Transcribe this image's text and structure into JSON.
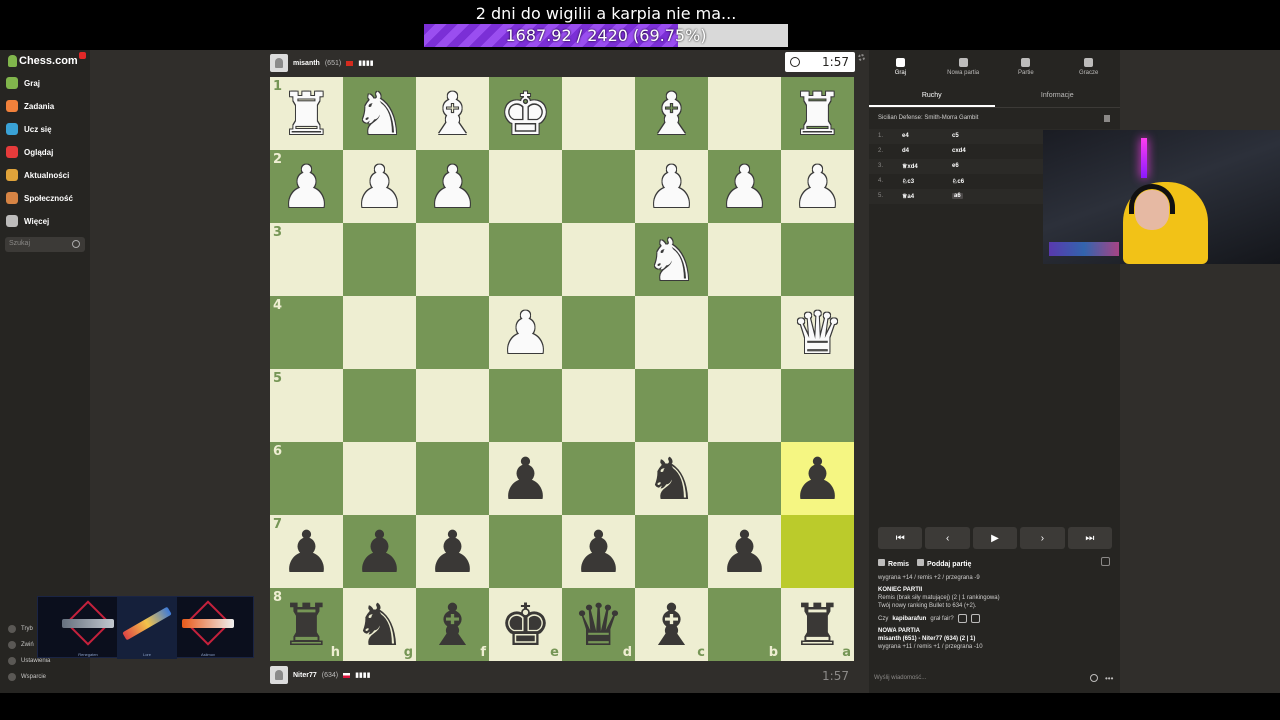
{
  "overlay": {
    "goal_title": "2 dni do wigilii a karpia nie ma...",
    "goal_text": "1687.92 / 2420 (69.75%)",
    "goal_progress": 0.6975
  },
  "sidebar": {
    "logo": "Chess.com",
    "items": [
      {
        "label": "Graj",
        "icon": "pawn-icon",
        "color": "#81b64c"
      },
      {
        "label": "Zadania",
        "icon": "puzzle-icon",
        "color": "#f1813b"
      },
      {
        "label": "Ucz się",
        "icon": "learn-icon",
        "color": "#3aa2d6"
      },
      {
        "label": "Oglądaj",
        "icon": "watch-icon",
        "color": "#e63b3b"
      },
      {
        "label": "Aktualności",
        "icon": "news-icon",
        "color": "#e0a33a"
      },
      {
        "label": "Społeczność",
        "icon": "community-icon",
        "color": "#d78444"
      },
      {
        "label": "Więcej",
        "icon": "more-icon",
        "color": "#bdbcbb"
      }
    ],
    "search_placeholder": "Szukaj",
    "bottom": [
      {
        "label": "Tryb",
        "icon": "theme-icon"
      },
      {
        "label": "Zwiń",
        "icon": "collapse-icon"
      },
      {
        "label": "Ustawienia",
        "icon": "settings-icon"
      },
      {
        "label": "Wsparcie",
        "icon": "help-icon"
      }
    ]
  },
  "skins": {
    "labels": [
      "Renegaten",
      "Lore",
      "Asiimov"
    ]
  },
  "players": {
    "top": {
      "name": "misanth",
      "rating": "(651)",
      "clock": "1:57",
      "bars": "▮▮▮▮"
    },
    "bottom": {
      "name": "Niter77",
      "rating": "(634)",
      "clock": "1:57",
      "bars": "▮▮▮▮"
    }
  },
  "board": {
    "ranks_labels": [
      "1",
      "2",
      "3",
      "4",
      "5",
      "6",
      "7",
      "8"
    ],
    "files_labels": [
      "h",
      "g",
      "f",
      "e",
      "d",
      "c",
      "b",
      "a"
    ],
    "rows": [
      [
        "wR",
        "wN",
        "wB",
        "wK",
        "",
        "wB",
        "",
        "wR"
      ],
      [
        "wP",
        "wP",
        "wP",
        "",
        "",
        "wP",
        "wP",
        "wP"
      ],
      [
        "",
        "",
        "",
        "",
        "",
        "wN",
        "",
        ""
      ],
      [
        "",
        "",
        "",
        "wP",
        "",
        "",
        "",
        "wQ"
      ],
      [
        "",
        "",
        "",
        "",
        "",
        "",
        "",
        ""
      ],
      [
        "",
        "",
        "",
        "bP",
        "",
        "bN",
        "",
        "bP"
      ],
      [
        "bP",
        "bP",
        "bP",
        "",
        "bP",
        "",
        "bP",
        ""
      ],
      [
        "bR",
        "bN",
        "bB",
        "bK",
        "bQ",
        "bB",
        "",
        "bR"
      ]
    ],
    "highlights": [
      [
        5,
        7
      ],
      [
        6,
        7
      ]
    ],
    "colors": {
      "light": "#eeeed2",
      "dark": "#769656",
      "hl_light": "#f5f682",
      "hl_dark": "#bbcb2b"
    }
  },
  "panel": {
    "tabs": [
      {
        "label": "Graj",
        "icon": "play-icon",
        "active": true
      },
      {
        "label": "Nowa partia",
        "icon": "new-game-icon",
        "active": false
      },
      {
        "label": "Partie",
        "icon": "games-icon",
        "active": false
      },
      {
        "label": "Gracze",
        "icon": "players-icon",
        "active": false
      }
    ],
    "subtabs": [
      {
        "label": "Ruchy",
        "active": true
      },
      {
        "label": "Informacje",
        "active": false
      }
    ],
    "opening": "Sicilian Defense: Smith-Morra Gambit",
    "moves": [
      {
        "num": "1.",
        "white": "e4",
        "black": "c5"
      },
      {
        "num": "2.",
        "white": "d4",
        "black": "cxd4"
      },
      {
        "num": "3.",
        "white": "♕xd4",
        "black": "e6"
      },
      {
        "num": "4.",
        "white": "♘c3",
        "black": "♘c6"
      },
      {
        "num": "5.",
        "white": "♕a4",
        "black": "a6"
      }
    ],
    "nav": [
      "⏮",
      "‹",
      "▶",
      "›",
      "⏭"
    ],
    "actions": [
      {
        "label": "Remis",
        "icon": "draw-icon"
      },
      {
        "label": "Poddaj partię",
        "icon": "resign-flag-icon"
      }
    ],
    "chat": {
      "line1": "wygrana +14 / remis +2 / przegrana -9",
      "end_title": "KONIEC PARTII",
      "end_line1": "Remis (brak siły matującej) (2 | 1 rankingowa)",
      "end_line2": "Twój nowy ranking Bullet to 634 (+2).",
      "fair_prefix": "Czy",
      "fair_name": "kapibarafun",
      "fair_suffix": "grał fair?",
      "new_title": "NOWA PARTIA",
      "new_line1": "misanth (651) - Niter77 (634) (2 | 1)",
      "new_line2": "wygrana +11 / remis +1 / przegrana -10",
      "input_placeholder": "Wyślij wiadomość..."
    }
  }
}
